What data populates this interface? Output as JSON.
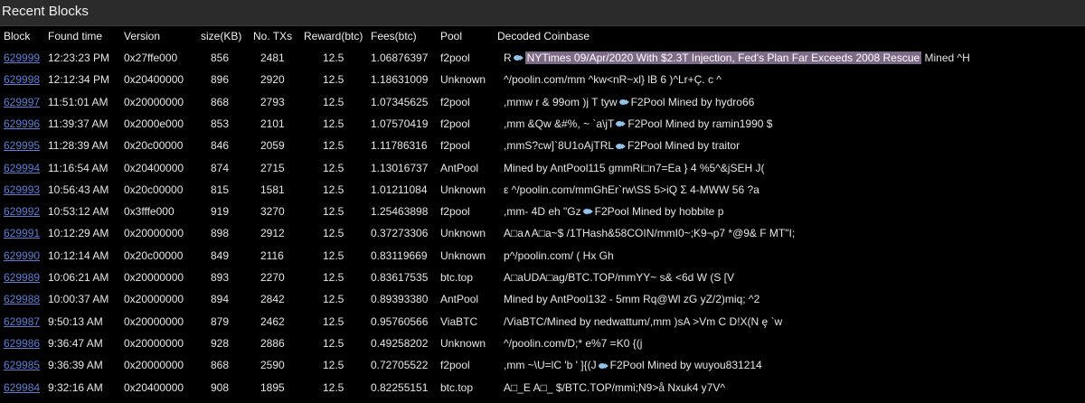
{
  "page": {
    "title": "Recent Blocks"
  },
  "columns": {
    "block": "Block",
    "found_time": "Found time",
    "version": "Version",
    "size": "size(KB)",
    "txs": "No. TXs",
    "reward": "Reward(btc)",
    "fees": "Fees(btc)",
    "pool": "Pool",
    "coinbase": "Decoded Coinbase"
  },
  "rows": [
    {
      "block": "629999",
      "time": "12:23:23 PM",
      "version": "0x27ffe000",
      "size": "856",
      "txs": "2481",
      "reward": "12.5",
      "fees": "1.06876397",
      "pool": "f2pool",
      "cb_pre": "R",
      "cb_fish": true,
      "cb_highlight": "NYTimes 09/Apr/2020 With $2.3T Injection, Fed's Plan Far Exceeds 2008 Rescue",
      "cb_post": " Mined  ^H"
    },
    {
      "block": "629998",
      "time": "12:12:34 PM",
      "version": "0x20400000",
      "size": "896",
      "txs": "2920",
      "reward": "12.5",
      "fees": "1.18631009",
      "pool": "Unknown",
      "cb_pre": " ^/poolin.com/mm ^kw<nR~xl} lB  6 )^Lr+Ç. c ^",
      "cb_fish": false,
      "cb_highlight": "",
      "cb_post": ""
    },
    {
      "block": "629997",
      "time": "11:51:01 AM",
      "version": "0x20000000",
      "size": "868",
      "txs": "2793",
      "reward": "12.5",
      "fees": "1.07345625",
      "pool": "f2pool",
      "cb_pre": ",mmw r & 99om )j    T tyw",
      "cb_fish": true,
      "cb_highlight": "",
      "cb_post": "F2Pool Mined by hydro66"
    },
    {
      "block": "629996",
      "time": "11:39:37 AM",
      "version": "0x2000e000",
      "size": "853",
      "txs": "2101",
      "reward": "12.5",
      "fees": "1.07570419",
      "pool": "f2pool",
      "cb_pre": ",mm  &Qw  &#%, ~ `a\\jT",
      "cb_fish": true,
      "cb_highlight": "",
      "cb_post": "F2Pool Mined by ramin1990 $"
    },
    {
      "block": "629995",
      "time": "11:28:39 AM",
      "version": "0x20c00000",
      "size": "846",
      "txs": "2059",
      "reward": "12.5",
      "fees": "1.11786316",
      "pool": "f2pool",
      "cb_pre": ",mmS?cw]`8U1oAjTRL",
      "cb_fish": true,
      "cb_highlight": "",
      "cb_post": "F2Pool Mined by traitor"
    },
    {
      "block": "629994",
      "time": "11:16:54 AM",
      "version": "0x20400000",
      "size": "874",
      "txs": "2715",
      "reward": "12.5",
      "fees": "1.13016737",
      "pool": "AntPool",
      "cb_pre": " Mined by AntPool115  gmmRi□n7=Ea } 4 %5^&jSEH    J(",
      "cb_fish": false,
      "cb_highlight": "",
      "cb_post": ""
    },
    {
      "block": "629993",
      "time": "10:56:43 AM",
      "version": "0x20c00000",
      "size": "815",
      "txs": "1581",
      "reward": "12.5",
      "fees": "1.01211084",
      "pool": "Unknown",
      "cb_pre": "ε ^/poolin.com/mmGhEr`rw\\SS 5>iQ Σ      4-MWW  56 ?a",
      "cb_fish": false,
      "cb_highlight": "",
      "cb_post": ""
    },
    {
      "block": "629992",
      "time": "10:53:12 AM",
      "version": "0x3fffe000",
      "size": "919",
      "txs": "3270",
      "reward": "12.5",
      "fees": "1.25463898",
      "pool": "f2pool",
      "cb_pre": ",mm- 4D eh     \"Gz",
      "cb_fish": true,
      "cb_highlight": "",
      "cb_post": "F2Pool Mined by hobbite p"
    },
    {
      "block": "629991",
      "time": "10:12:29 AM",
      "version": "0x20000000",
      "size": "898",
      "txs": "2912",
      "reward": "12.5",
      "fees": "0.37273306",
      "pool": "Unknown",
      "cb_pre": "A□a∧A□a~$ /1THash&58COIN/mmI0~;K9¬p7 *@9& F MT\"I;",
      "cb_fish": false,
      "cb_highlight": "",
      "cb_post": ""
    },
    {
      "block": "629990",
      "time": "10:12:14 AM",
      "version": "0x20c00000",
      "size": "849",
      "txs": "2116",
      "reward": "12.5",
      "fees": "0.83119669",
      "pool": "Unknown",
      "cb_pre": " p^/poolin.com/ ( Hx Gh",
      "cb_fish": false,
      "cb_highlight": "",
      "cb_post": ""
    },
    {
      "block": "629989",
      "time": "10:06:21 AM",
      "version": "0x20000000",
      "size": "893",
      "txs": "2270",
      "reward": "12.5",
      "fees": "0.83617535",
      "pool": "btc.top",
      "cb_pre": "A□aUDA□ag/BTC.TOP/mmYY~ s&    <6d W  (S [V",
      "cb_fish": false,
      "cb_highlight": "",
      "cb_post": ""
    },
    {
      "block": "629988",
      "time": "10:00:37 AM",
      "version": "0x20000000",
      "size": "894",
      "txs": "2842",
      "reward": "12.5",
      "fees": "0.89393380",
      "pool": "AntPool",
      "cb_pre": " Mined by AntPool132 -  5mm Rq@Wl zG  yZ/2)miq; ^2",
      "cb_fish": false,
      "cb_highlight": "",
      "cb_post": ""
    },
    {
      "block": "629987",
      "time": "9:50:13 AM",
      "version": "0x20000000",
      "size": "879",
      "txs": "2462",
      "reward": "12.5",
      "fees": "0.95760566",
      "pool": "ViaBTC",
      "cb_pre": "  /ViaBTC/Mined by nedwattum/,mm  )sA  >Vm C D!X(N       ȩ `w",
      "cb_fish": false,
      "cb_highlight": "",
      "cb_post": ""
    },
    {
      "block": "629986",
      "time": "9:36:47 AM",
      "version": "0x20000000",
      "size": "928",
      "txs": "2886",
      "reward": "12.5",
      "fees": "0.49258202",
      "pool": "Unknown",
      "cb_pre": " ^/poolin.com/D;* e%7 =K0 {(j",
      "cb_fish": false,
      "cb_highlight": "",
      "cb_post": ""
    },
    {
      "block": "629985",
      "time": "9:36:39 AM",
      "version": "0x20000000",
      "size": "868",
      "txs": "2590",
      "reward": "12.5",
      "fees": "0.72705522",
      "pool": "f2pool",
      "cb_pre": ",mm ~\\U=lC 'b '  ]{(J",
      "cb_fish": true,
      "cb_highlight": "",
      "cb_post": "F2Pool Mined by wuyou831214"
    },
    {
      "block": "629984",
      "time": "9:32:16 AM",
      "version": "0x20400000",
      "size": "908",
      "txs": "1895",
      "reward": "12.5",
      "fees": "0.82255151",
      "pool": "btc.top",
      "cb_pre": "A□_E A□_ $/BTC.TOP/mmὶ;N9>å Nxuk4 y7V^",
      "cb_fish": false,
      "cb_highlight": "",
      "cb_post": ""
    }
  ]
}
